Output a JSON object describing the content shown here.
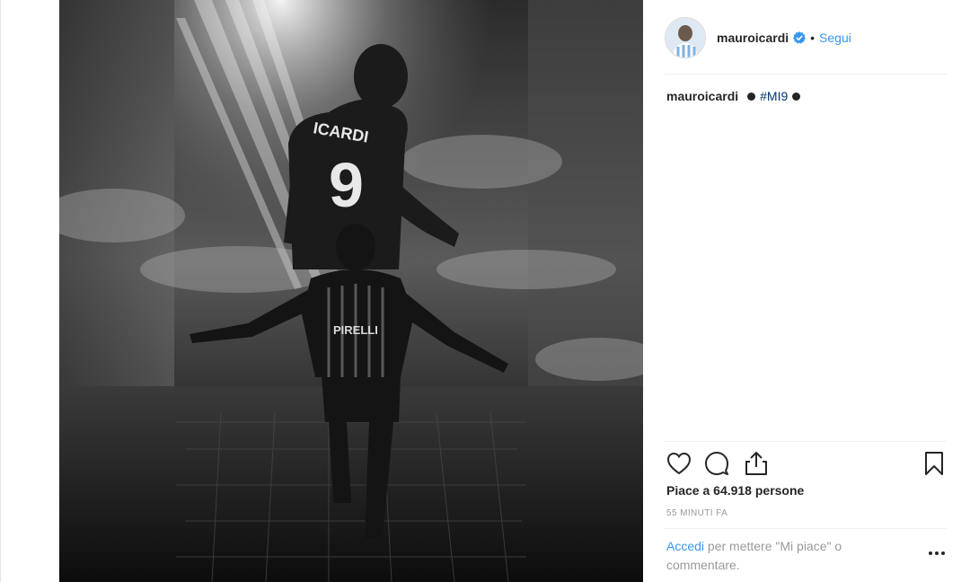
{
  "post": {
    "username": "mauroicardi",
    "follow_label": "Segui",
    "dot": "•",
    "caption_user": "mauroicardi",
    "hashtag": "#MI9",
    "likes_text": "Piace a 64.918 persone",
    "timestamp": "55 MINUTI FA",
    "login_link": "Accedi",
    "login_text": " per mettere \"Mi piace\" o commentare.",
    "more_label": "..."
  },
  "media": {
    "jersey_name": "ICARDI",
    "jersey_number": "9",
    "shirt_sponsor": "PIRELLI"
  },
  "colors": {
    "link": "#3897f0",
    "hashtag": "#003569",
    "muted": "#999999",
    "text": "#262626",
    "verified": "#3897f0"
  },
  "icons": [
    "heart-icon",
    "comment-icon",
    "share-icon",
    "bookmark-icon",
    "verified-badge-icon",
    "more-options-icon"
  ]
}
